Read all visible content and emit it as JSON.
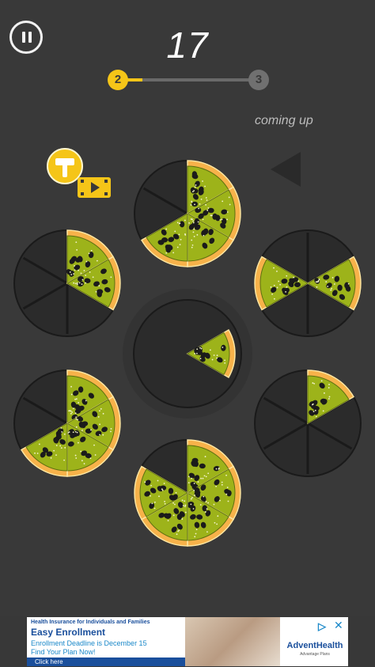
{
  "hud": {
    "score": "17",
    "level_current": "2",
    "level_next": "3",
    "level_progress": 0.18,
    "coming_up_label": "coming up"
  },
  "booster": {
    "icon": "hammer-icon",
    "video_icon": "video-ad-icon"
  },
  "colors": {
    "crust": "#f7b24a",
    "crust_light": "#fde6a3",
    "sauce": "#9db31a",
    "sauce_dark": "#5d7010",
    "olive": "#1b1b1b",
    "plate": "#2b2b2b",
    "plate_ring": "#1a1a1a",
    "accent": "#f5c518"
  },
  "pizzas": [
    {
      "id": "top",
      "slices": [
        0,
        1,
        2,
        3
      ]
    },
    {
      "id": "upper-left",
      "slices": [
        0,
        1
      ]
    },
    {
      "id": "upper-right",
      "slices": [
        1,
        4
      ]
    },
    {
      "id": "center",
      "slices": [
        1
      ]
    },
    {
      "id": "lower-left",
      "slices": [
        0,
        1,
        2,
        3
      ]
    },
    {
      "id": "lower-right",
      "slices": [
        0
      ]
    },
    {
      "id": "bottom",
      "slices": [
        0,
        1,
        2,
        3,
        4
      ]
    }
  ],
  "coming_up_slice": {
    "shape": "slice-preview-icon"
  },
  "ad": {
    "line1": "Health Insurance for Individuals and Families",
    "line2": "Easy Enrollment",
    "line3": "Enrollment Deadline is December 15",
    "line4": "Find Your Plan Now!",
    "cta": "Click here",
    "brand": "AdventHealth",
    "brand_sub": "Advantage Plans"
  }
}
